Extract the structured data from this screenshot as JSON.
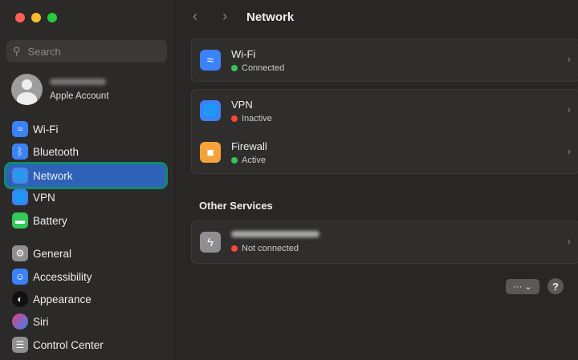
{
  "window": {
    "title": "Network"
  },
  "sidebar": {
    "search_placeholder": "Search",
    "account": {
      "subtitle": "Apple Account"
    },
    "items": [
      {
        "label": "Wi-Fi",
        "icon": "wifi-icon",
        "color": "#3b82f6"
      },
      {
        "label": "Bluetooth",
        "icon": "bluetooth-icon",
        "color": "#3b82f6"
      },
      {
        "label": "Network",
        "icon": "globe-icon",
        "color": "#3b82f6",
        "selected": true
      },
      {
        "label": "VPN",
        "icon": "globe-icon",
        "color": "#3b82f6"
      },
      {
        "label": "Battery",
        "icon": "battery-icon",
        "color": "#34c759"
      },
      {
        "label": "General",
        "icon": "gear-icon",
        "color": "#8e8e93"
      },
      {
        "label": "Accessibility",
        "icon": "accessibility-icon",
        "color": "#3b82f6"
      },
      {
        "label": "Appearance",
        "icon": "appearance-icon",
        "color": "#111111"
      },
      {
        "label": "Siri",
        "icon": "siri-icon",
        "color": "#8a4fd6"
      },
      {
        "label": "Control Center",
        "icon": "control-center-icon",
        "color": "#8e8e93"
      }
    ]
  },
  "main": {
    "services": [
      {
        "name": "Wi-Fi",
        "status": "Connected",
        "status_color": "#34c759"
      },
      {
        "name": "VPN",
        "status": "Inactive",
        "status_color": "#ff453a"
      },
      {
        "name": "Firewall",
        "status": "Active",
        "status_color": "#34c759"
      }
    ],
    "other_services_heading": "Other Services",
    "other": [
      {
        "status": "Not connected",
        "status_color": "#ff453a"
      }
    ],
    "more_label": "···",
    "help_label": "?"
  }
}
